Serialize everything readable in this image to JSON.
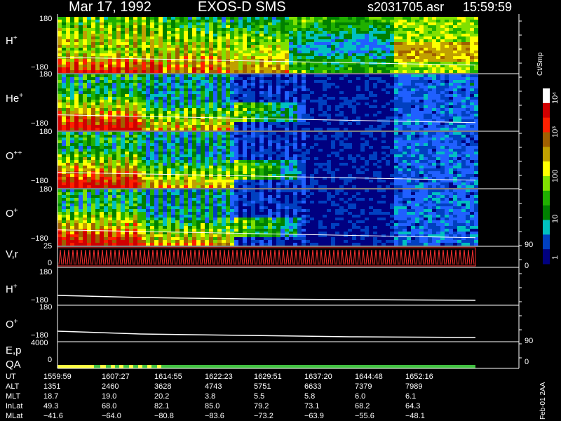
{
  "header": {
    "date": "Mar 17, 1992",
    "instrument": "EXOS-D SMS",
    "file": "s2031705.asr",
    "time": "15:59:59"
  },
  "chart_data": {
    "type": "heatmap",
    "panels": [
      {
        "label": "H",
        "sup": "+",
        "ytop": "180",
        "ybottom": "−180",
        "kind": "spectrogram"
      },
      {
        "label": "He",
        "sup": "+",
        "ytop": "180",
        "ybottom": "−180",
        "kind": "spectrogram"
      },
      {
        "label": "O",
        "sup": "++",
        "ytop": "180",
        "ybottom": "−180",
        "kind": "spectrogram"
      },
      {
        "label": "O",
        "sup": "+",
        "ytop": "180",
        "ybottom": "−180",
        "kind": "spectrogram"
      },
      {
        "label": "V,r",
        "sup": "",
        "ytop": "25",
        "ybottom": "0",
        "right_top": "90",
        "right_bottom": "0",
        "kind": "line"
      },
      {
        "label": "H",
        "sup": "+",
        "ytop": "180",
        "ybottom": "−180",
        "kind": "line"
      },
      {
        "label": "O",
        "sup": "+",
        "ytop": "180",
        "ybottom": "−180",
        "kind": "line"
      },
      {
        "label": "E,p",
        "label2": "QA",
        "sup": "",
        "ytop": "4000",
        "ybottom": "0",
        "right_top": "90",
        "right_bottom": "0",
        "kind": "line"
      }
    ],
    "colorbar": {
      "unit": "Ct/Smp",
      "labels": [
        "10⁴",
        "10³",
        "100",
        "10",
        "1"
      ],
      "colors": [
        "#ffffff",
        "#d00000",
        "#ff2000",
        "#a06000",
        "#c0a000",
        "#ffff00",
        "#80e000",
        "#20b000",
        "#008000",
        "#00c0c0",
        "#0040c0",
        "#000080"
      ]
    },
    "ephemeris": {
      "rows": [
        {
          "name": "UT",
          "values": [
            "1559:59",
            "1607:27",
            "1614:55",
            "1622:23",
            "1629:51",
            "1637:20",
            "1644:48",
            "1652:16"
          ]
        },
        {
          "name": "ALT",
          "values": [
            "1351",
            "2460",
            "3628",
            "4743",
            "5751",
            "6633",
            "7379",
            "7989"
          ]
        },
        {
          "name": "MLT",
          "values": [
            "18.7",
            "19.0",
            "20.2",
            "3.8",
            "5.5",
            "5.8",
            "6.0",
            "6.1"
          ]
        },
        {
          "name": "InLat",
          "values": [
            "49.3",
            "68.0",
            "82.1",
            "85.0",
            "79.2",
            "73.1",
            "68.2",
            "64.3"
          ]
        },
        {
          "name": "MLat",
          "values": [
            "−41.6",
            "−64.0",
            "−80.8",
            "−83.6",
            "−73.2",
            "−63.9",
            "−55.6",
            "−48.1"
          ]
        }
      ]
    },
    "footer_note": "Feb-01 2AA"
  }
}
